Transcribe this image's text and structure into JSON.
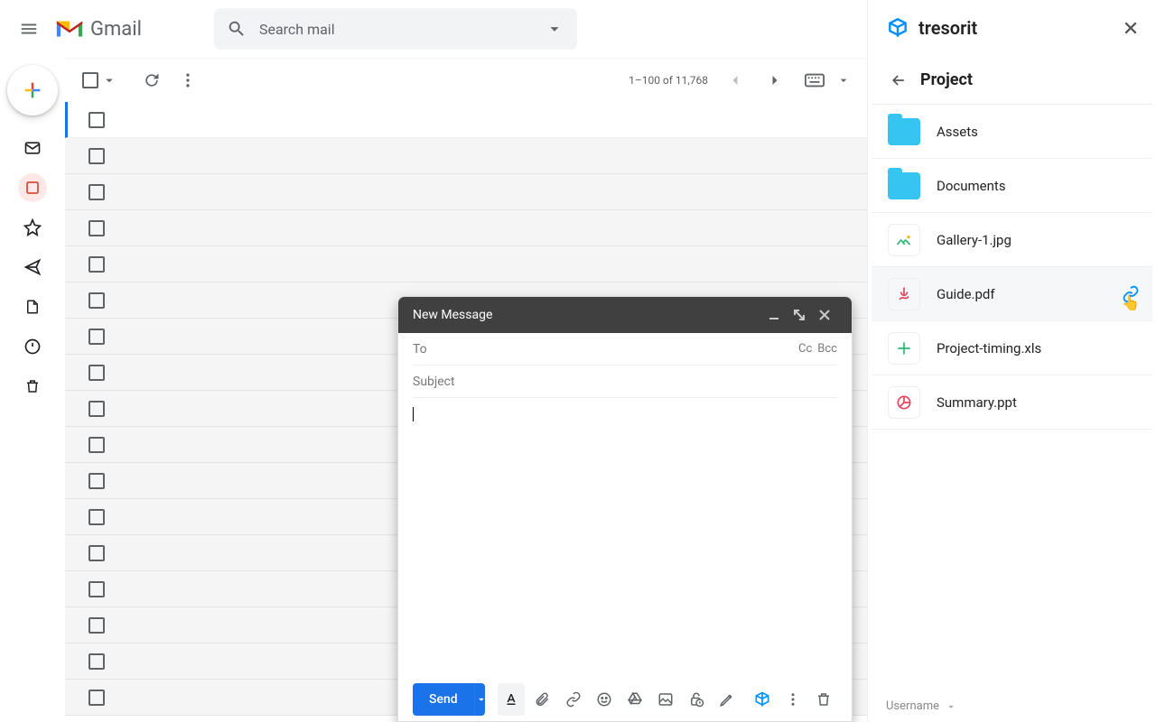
{
  "header": {
    "gmail_label": "Gmail",
    "search_placeholder": "Search mail"
  },
  "toolbar": {
    "pager": "1–100 of 11,768"
  },
  "compose": {
    "title": "New Message",
    "to_label": "To",
    "cc": "Cc",
    "bcc": "Bcc",
    "subject_label": "Subject",
    "send_label": "Send"
  },
  "panel": {
    "brand": "tresorit",
    "breadcrumb": "Project",
    "items": [
      {
        "name": "Assets",
        "type": "folder"
      },
      {
        "name": "Documents",
        "type": "folder"
      },
      {
        "name": "Gallery-1.jpg",
        "type": "image"
      },
      {
        "name": "Guide.pdf",
        "type": "pdf",
        "hover": true
      },
      {
        "name": "Project-timing.xls",
        "type": "xls"
      },
      {
        "name": "Summary.ppt",
        "type": "ppt"
      }
    ],
    "footer": "Username"
  }
}
